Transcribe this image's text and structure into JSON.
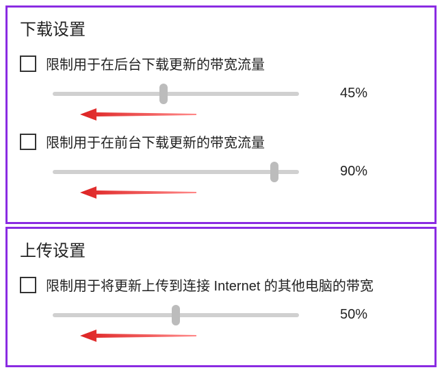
{
  "download": {
    "title": "下载设置",
    "settings": [
      {
        "label": "限制用于在后台下载更新的带宽流量",
        "checked": false,
        "value": 45,
        "display": "45%"
      },
      {
        "label": "限制用于在前台下载更新的带宽流量",
        "checked": false,
        "value": 90,
        "display": "90%"
      }
    ]
  },
  "upload": {
    "title": "上传设置",
    "settings": [
      {
        "label": "限制用于将更新上传到连接 Internet 的其他电脑的带宽",
        "checked": false,
        "value": 50,
        "display": "50%"
      }
    ]
  }
}
